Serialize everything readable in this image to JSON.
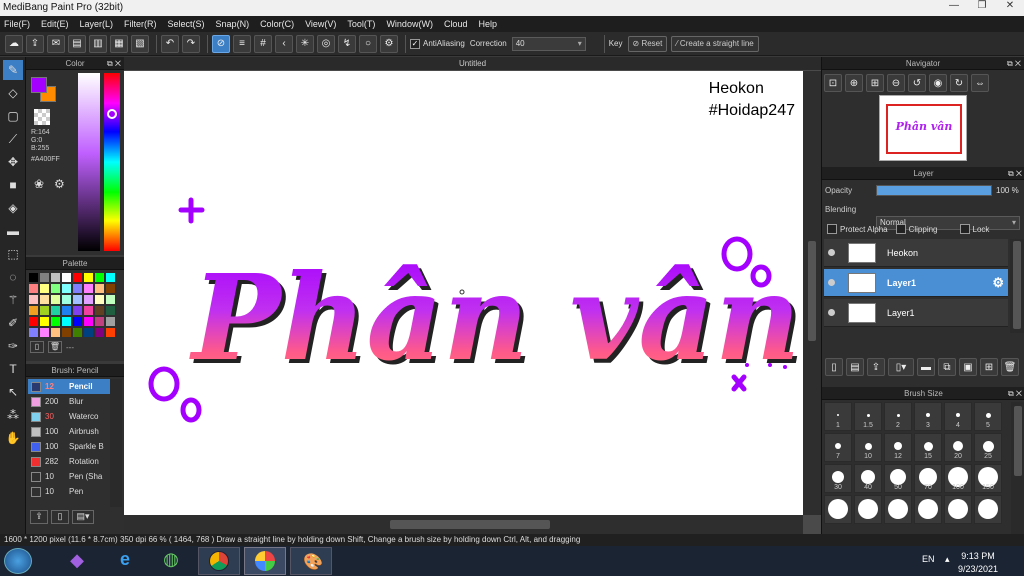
{
  "window": {
    "title": "MediBang Paint Pro (32bit)",
    "min": "—",
    "max": "❐",
    "close": "✕"
  },
  "menu": [
    "File(F)",
    "Edit(E)",
    "Layer(L)",
    "Filter(R)",
    "Select(S)",
    "Snap(N)",
    "Color(C)",
    "View(V)",
    "Tool(T)",
    "Window(W)",
    "Cloud",
    "Help"
  ],
  "toolbar": {
    "antialias_label": "AntiAliasing",
    "antialias_checked": true,
    "correction_label": "Correction",
    "correction_value": "40",
    "key_label": "Key",
    "reset_label": "Reset",
    "straight_line_label": "Create a straight line"
  },
  "document": {
    "tab_title": "Untitled"
  },
  "canvas_text": {
    "heading_line1": "Heokon",
    "heading_line2": "#Hoidap247",
    "artwork_text": "Phân vân"
  },
  "color_panel": {
    "title": "Color",
    "r": "R:164",
    "g": "G:0",
    "b": "B:255",
    "hex": "#A400FF",
    "main_color": "#A400FF",
    "sub_color": "#FF8C00"
  },
  "palette_panel": {
    "title": "Palette",
    "value": "---",
    "colors": [
      [
        "#000000",
        "#808080",
        "#c0c0c0",
        "#ffffff",
        "#ff0000",
        "#ffff00",
        "#00ff00",
        "#00ffff",
        "#0000ff",
        "#ff00ff",
        "#c04080",
        "#a0a0a0"
      ],
      [
        "#ff8080",
        "#ffff80",
        "#80ff80",
        "#80ffff",
        "#8080ff",
        "#ff80ff",
        "#ffc080",
        "#804000",
        "#408000",
        "#004080",
        "#800080",
        "#ff4000"
      ],
      [
        "#ffc0c0",
        "#ffe0a0",
        "#e0ffa0",
        "#a0ffe0",
        "#a0c0ff",
        "#e0a0ff",
        "#ffffc0",
        "#c0ffc0",
        "#c0ffff",
        "#c0c0ff",
        "#ffc0ff",
        "#ff0080"
      ],
      [
        "#f0a020",
        "#a0d020",
        "#20d0a0",
        "#2080f0",
        "#8040f0",
        "#f040a0",
        "#604020",
        "#206040",
        "#204060",
        "#402060",
        "#606020",
        "#ff6060"
      ]
    ]
  },
  "brush_panel": {
    "title": "Brush: Pencil",
    "items": [
      {
        "size": "12",
        "name": "Pencil",
        "color": "#2a3a70"
      },
      {
        "size": "200",
        "name": "Blur",
        "color": "#f0a0e0"
      },
      {
        "size": "30",
        "name": "Waterco",
        "color": "#80d0f0"
      },
      {
        "size": "100",
        "name": "Airbrush",
        "color": "#c0c0c0"
      },
      {
        "size": "100",
        "name": "Sparkle B",
        "color": "#4060f0"
      },
      {
        "size": "282",
        "name": "Rotation",
        "color": "#f03030"
      },
      {
        "size": "10",
        "name": "Pen (Sha",
        "color": "#303030"
      },
      {
        "size": "10",
        "name": "Pen",
        "color": "#303030"
      }
    ]
  },
  "navigator": {
    "title": "Navigator",
    "thumb_text": "Phân vân"
  },
  "layer_panel": {
    "title": "Layer",
    "opacity_label": "Opacity",
    "opacity_value": "100 %",
    "opacity_fraction": 1.0,
    "blending_label": "Blending",
    "blending_value": "Normal",
    "protect_alpha": "Protect Alpha",
    "clipping": "Clipping",
    "lock": "Lock",
    "layers": [
      {
        "name": "Heokon",
        "selected": false
      },
      {
        "name": "Layer1",
        "selected": true
      },
      {
        "name": "Layer1",
        "selected": false
      }
    ]
  },
  "brush_size_panel": {
    "title": "Brush Size",
    "sizes": [
      "1",
      "1.5",
      "2",
      "3",
      "4",
      "5",
      "7",
      "10",
      "12",
      "15",
      "20",
      "25",
      "30",
      "40",
      "50",
      "70",
      "100",
      "150"
    ]
  },
  "status": {
    "pixel": "1600 * 1200 pixel",
    "physical": "(11.6 * 8.7cm)",
    "dpi": "350 dpi",
    "zoom": "66 %",
    "coords": "( 1464, 768 )",
    "hint": "Draw a straight line by holding down Shift, Change a brush size by holding down Ctrl, Alt, and dragging"
  },
  "taskbar": {
    "lang": "EN",
    "time": "9:13 PM",
    "date": "9/23/2021"
  }
}
